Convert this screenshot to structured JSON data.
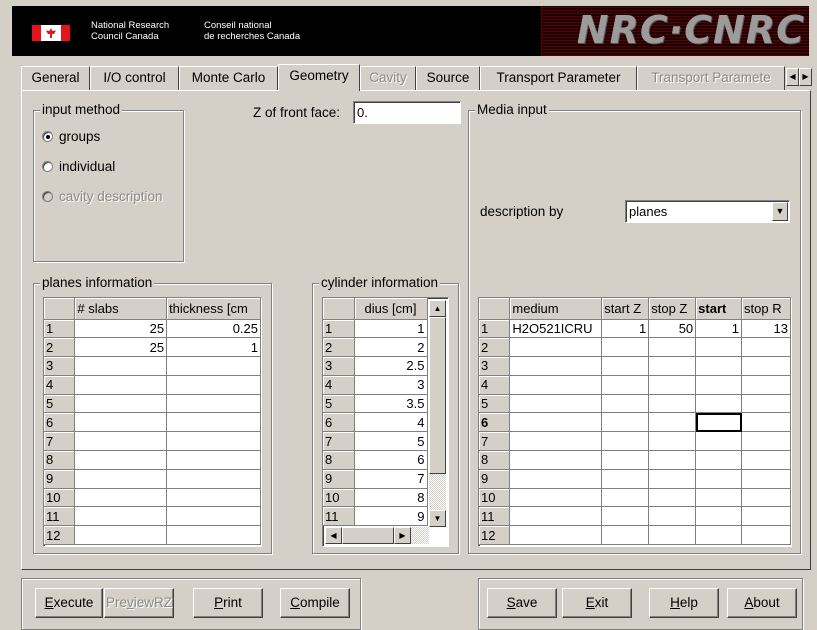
{
  "banner": {
    "en_line1": "National Research",
    "en_line2": "Council Canada",
    "fr_line1": "Conseil national",
    "fr_line2": "de recherches Canada",
    "logo_text": "NRC·CNRC"
  },
  "tabs": [
    {
      "label": "General",
      "state": "normal"
    },
    {
      "label": "I/O control",
      "state": "normal"
    },
    {
      "label": "Monte Carlo",
      "state": "normal"
    },
    {
      "label": "Geometry",
      "state": "active"
    },
    {
      "label": "Cavity",
      "state": "disabled"
    },
    {
      "label": "Source",
      "state": "normal"
    },
    {
      "label": "Transport Parameter",
      "state": "normal"
    },
    {
      "label": "Transport Paramete",
      "state": "disabled"
    }
  ],
  "input_method": {
    "title": "input method",
    "options": [
      {
        "label": "groups",
        "selected": true,
        "enabled": true
      },
      {
        "label": "individual",
        "selected": false,
        "enabled": true
      },
      {
        "label": "cavity description",
        "selected": false,
        "enabled": false
      }
    ]
  },
  "front_face": {
    "label": "Z of front face:",
    "value": "0."
  },
  "planes": {
    "title": "planes information",
    "columns": [
      "# slabs",
      "thickness [cm"
    ],
    "rows": [
      [
        "1",
        "25",
        "0.25"
      ],
      [
        "2",
        "25",
        "1"
      ],
      [
        "3",
        "",
        ""
      ],
      [
        "4",
        "",
        ""
      ],
      [
        "5",
        "",
        ""
      ],
      [
        "6",
        "",
        ""
      ],
      [
        "7",
        "",
        ""
      ],
      [
        "8",
        "",
        ""
      ],
      [
        "9",
        "",
        ""
      ],
      [
        "10",
        "",
        ""
      ],
      [
        "11",
        "",
        ""
      ],
      [
        "12",
        "",
        ""
      ]
    ]
  },
  "cylinder": {
    "title": "cylinder information",
    "columns": [
      "dius [cm]"
    ],
    "rows": [
      [
        "1",
        "1"
      ],
      [
        "2",
        "2"
      ],
      [
        "3",
        "2.5"
      ],
      [
        "4",
        "3"
      ],
      [
        "5",
        "3.5"
      ],
      [
        "6",
        "4"
      ],
      [
        "7",
        "5"
      ],
      [
        "8",
        "6"
      ],
      [
        "9",
        "7"
      ],
      [
        "10",
        "8"
      ],
      [
        "11",
        "9"
      ]
    ]
  },
  "media": {
    "title": "Media input",
    "description_label": "description by",
    "description_value": "planes",
    "columns": [
      "medium",
      "start Z",
      "stop Z",
      "start",
      "stop R"
    ],
    "rows": [
      [
        "1",
        "H2O521ICRU",
        "1",
        "50",
        "1",
        "13"
      ],
      [
        "2",
        "",
        "",
        "",
        "",
        ""
      ],
      [
        "3",
        "",
        "",
        "",
        "",
        ""
      ],
      [
        "4",
        "",
        "",
        "",
        "",
        ""
      ],
      [
        "5",
        "",
        "",
        "",
        "",
        ""
      ],
      [
        "6",
        "",
        "",
        "",
        "",
        ""
      ],
      [
        "7",
        "",
        "",
        "",
        "",
        ""
      ],
      [
        "8",
        "",
        "",
        "",
        "",
        ""
      ],
      [
        "9",
        "",
        "",
        "",
        "",
        ""
      ],
      [
        "10",
        "",
        "",
        "",
        "",
        ""
      ],
      [
        "11",
        "",
        "",
        "",
        "",
        ""
      ],
      [
        "12",
        "",
        "",
        "",
        "",
        ""
      ]
    ]
  },
  "buttons_left": [
    {
      "pre": "",
      "ul": "E",
      "post": "xecute",
      "enabled": true
    },
    {
      "pre": "Pre",
      "ul": "v",
      "post": "iewRZ",
      "enabled": false
    },
    {
      "pre": "",
      "ul": "P",
      "post": "rint",
      "enabled": true
    },
    {
      "pre": "",
      "ul": "C",
      "post": "ompile",
      "enabled": true
    }
  ],
  "buttons_right": [
    {
      "pre": "",
      "ul": "S",
      "post": "ave",
      "enabled": true
    },
    {
      "pre": "",
      "ul": "E",
      "post": "xit",
      "enabled": true
    },
    {
      "pre": "",
      "ul": "H",
      "post": "elp",
      "enabled": true
    },
    {
      "pre": "",
      "ul": "A",
      "post": "bout",
      "enabled": true
    }
  ]
}
